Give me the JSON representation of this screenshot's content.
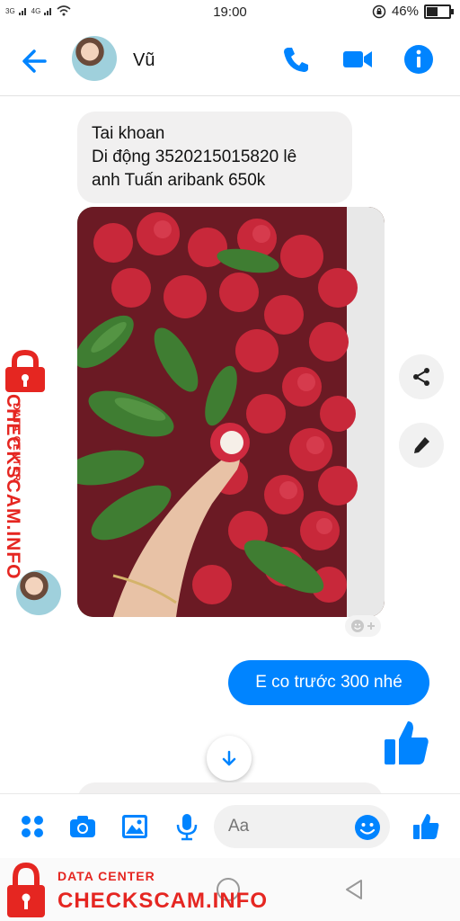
{
  "status_bar": {
    "network_left": "3G",
    "network_right": "4G",
    "time": "19:00",
    "battery": "46%"
  },
  "header": {
    "contact_name": "Vũ",
    "icons": [
      "back-arrow-icon",
      "phone-icon",
      "video-camera-icon",
      "info-icon"
    ],
    "accent_color": "#0084ff"
  },
  "messages": {
    "incoming_text_lines": [
      "Tai khoan",
      "Di động 3520215015820 lê",
      "anh Tuấn aribank 650k"
    ],
    "photo_subject": "rambutan",
    "side_actions": [
      "share-icon",
      "edit-pencil-icon"
    ],
    "reaction_icon": "emoji-add-icon",
    "outgoing_text": "E co trước 300 nhé",
    "outgoing_sticker": "like-icon"
  },
  "composer": {
    "placeholder": "Aa",
    "icons": [
      "more-dots-icon",
      "camera-icon",
      "gallery-icon",
      "microphone-icon",
      "emoji-icon",
      "like-icon"
    ]
  },
  "watermark": {
    "top_line": "DATA CENTER",
    "main_line": "CHECKSCAM.INFO",
    "color": "#e52621"
  }
}
